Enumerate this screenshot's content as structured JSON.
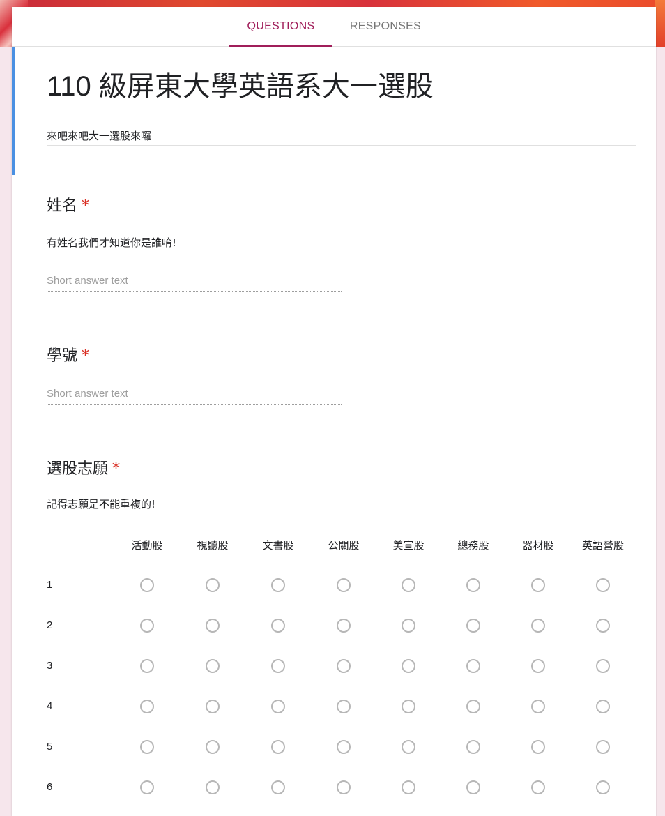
{
  "tabs": {
    "questions": "QUESTIONS",
    "responses": "RESPONSES"
  },
  "form": {
    "title": "110 級屏東大學英語系大一選股",
    "description": "來吧來吧大一選股來囉"
  },
  "questions": [
    {
      "title": "姓名",
      "required_mark": "*",
      "description": "有姓名我們才知道你是誰唷!",
      "placeholder": "Short answer text"
    },
    {
      "title": "學號",
      "required_mark": "*",
      "placeholder": "Short answer text"
    },
    {
      "title": "選股志願",
      "required_mark": "*",
      "description": "記得志願是不能重複的!",
      "columns": [
        "活動股",
        "視聽股",
        "文書股",
        "公關股",
        "美宣股",
        "總務股",
        "器材股",
        "英語營股"
      ],
      "rows": [
        "1",
        "2",
        "3",
        "4",
        "5",
        "6"
      ]
    }
  ],
  "colors": {
    "accent": "#a01e5a",
    "left_accent": "#4a90e2",
    "required": "#d93025",
    "background": "#f6e6ec"
  }
}
